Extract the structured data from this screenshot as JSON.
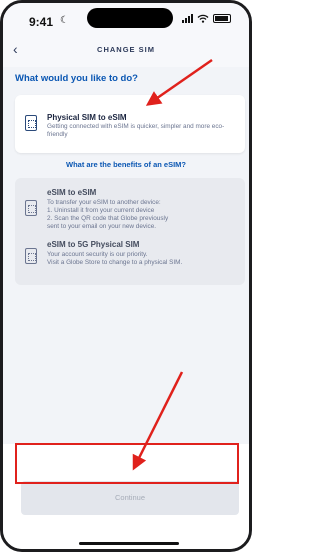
{
  "status_bar": {
    "time": "9:41"
  },
  "header": {
    "back_icon": "chevron-left-icon",
    "title": "CHANGE SIM"
  },
  "question": "What would you like to do?",
  "options": [
    {
      "title": "Physical SIM to eSIM",
      "description": "Getting connected with eSIM is quicker, simpler and more eco-friendly",
      "icon": "sim-card-icon",
      "enabled": true
    },
    {
      "title": "eSIM to eSIM",
      "description": "To transfer your eSIM to another device:\n1. Uninstall it from your current device\n2. Scan the QR code that Globe previously\n    sent to your email on your new device.",
      "icon": "sim-card-icon",
      "enabled": false
    },
    {
      "title": "eSIM to 5G Physical SIM",
      "description": "Your account security is our priority.\nVisit a Globe Store to change to a physical SIM.",
      "icon": "sim-card-icon",
      "enabled": false
    }
  ],
  "benefits_link": "What are the benefits of an eSIM?",
  "footer": {
    "continue_label": "Continue",
    "continue_enabled": false
  },
  "colors": {
    "accent": "#0b57b3",
    "annotation": "#e0211c",
    "disabled_button": "#e3e6ec"
  }
}
